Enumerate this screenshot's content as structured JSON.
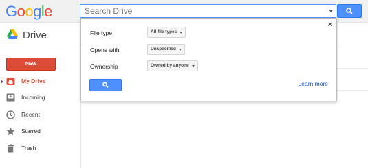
{
  "header": {
    "logo_letters": [
      "G",
      "o",
      "o",
      "g",
      "l",
      "e"
    ],
    "logo_colors": [
      "#4285f4",
      "#ea4335",
      "#fbbc05",
      "#4285f4",
      "#34a853",
      "#ea4335"
    ],
    "search_placeholder": "Search Drive",
    "search_button_icon": "search-icon"
  },
  "drivebar": {
    "title": "Drive",
    "icon": "drive-logo-icon"
  },
  "sidebar": {
    "new_label": "NEW",
    "items": [
      {
        "label": "My Drive",
        "icon": "my-drive-icon",
        "active": true
      },
      {
        "label": "Incoming",
        "icon": "incoming-icon",
        "active": false
      },
      {
        "label": "Recent",
        "icon": "clock-icon",
        "active": false
      },
      {
        "label": "Starred",
        "icon": "star-icon",
        "active": false
      },
      {
        "label": "Trash",
        "icon": "trash-icon",
        "active": false
      }
    ]
  },
  "search_options": {
    "close_glyph": "×",
    "file_type_label": "File type",
    "file_type_value": "All file types",
    "opens_with_label": "Opens with",
    "opens_with_value": "Unspecified",
    "ownership_label": "Ownership",
    "ownership_value": "Owned by anyone",
    "search_icon": "search-icon",
    "learn_more": "Learn more"
  },
  "colors": {
    "accent_blue": "#4d90fe",
    "new_red": "#dd4b39",
    "link_blue": "#1155cc"
  }
}
